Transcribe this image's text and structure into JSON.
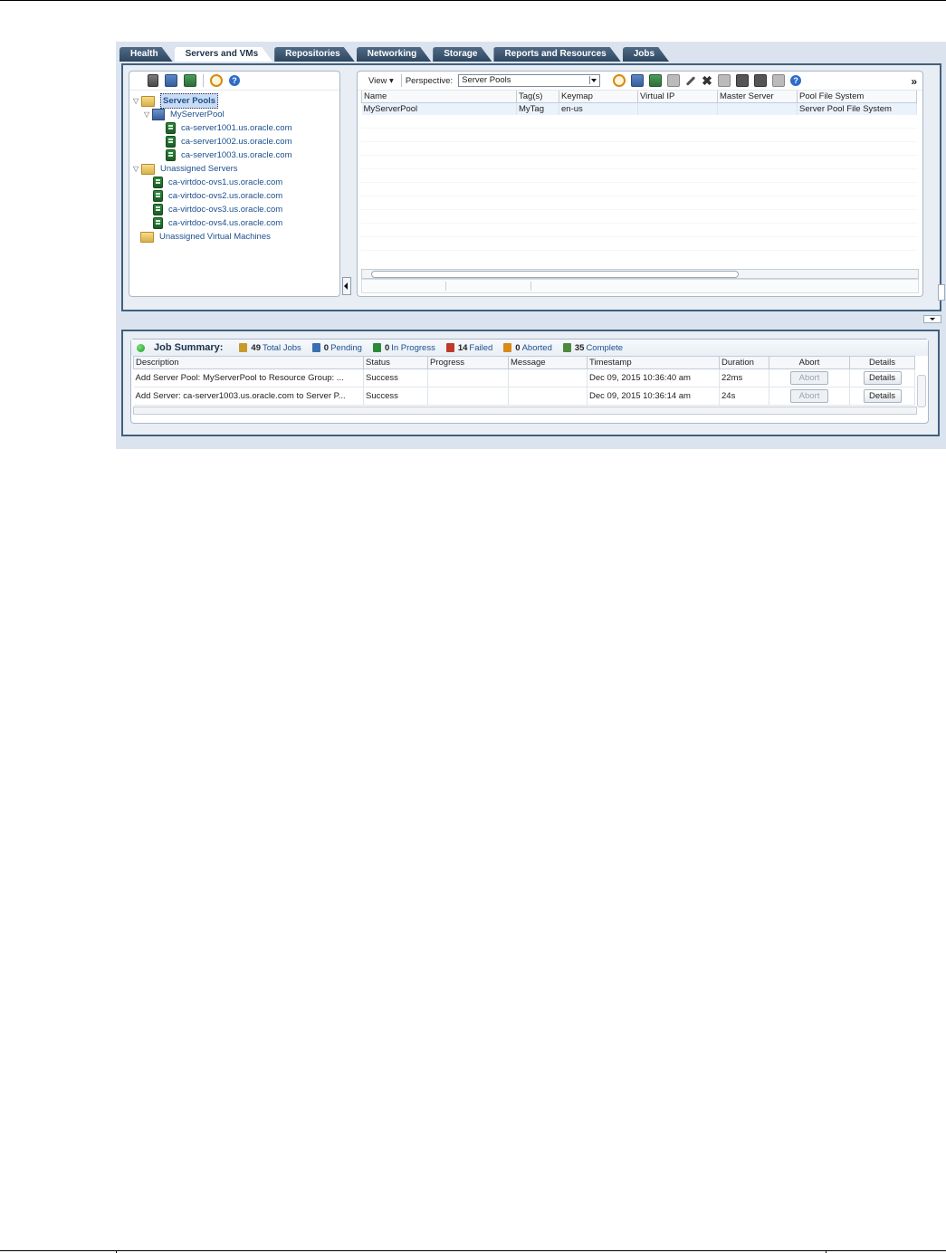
{
  "tabs": [
    {
      "label": "Health"
    },
    {
      "label": "Servers and VMs"
    },
    {
      "label": "Repositories"
    },
    {
      "label": "Networking"
    },
    {
      "label": "Storage"
    },
    {
      "label": "Reports and Resources"
    },
    {
      "label": "Jobs"
    }
  ],
  "active_tab": "Servers and VMs",
  "tree": {
    "server_pools": "Server Pools",
    "pool": "MyServerPool",
    "pool_servers": [
      "ca-server1001.us.oracle.com",
      "ca-server1002.us.oracle.com",
      "ca-server1003.us.oracle.com"
    ],
    "unassigned_servers": "Unassigned Servers",
    "unassigned_server_list": [
      "ca-virtdoc-ovs1.us.oracle.com",
      "ca-virtdoc-ovs2.us.oracle.com",
      "ca-virtdoc-ovs3.us.oracle.com",
      "ca-virtdoc-ovs4.us.oracle.com"
    ],
    "unassigned_vms": "Unassigned Virtual Machines"
  },
  "grid_toolbar": {
    "view_label": "View ▾",
    "perspective_label": "Perspective:",
    "perspective_value": "Server Pools",
    "more": "»"
  },
  "grid": {
    "columns": [
      "Name",
      "Tag(s)",
      "Keymap",
      "Virtual IP",
      "Master Server",
      "Pool File System"
    ],
    "rows": [
      {
        "name": "MyServerPool",
        "tags": "MyTag",
        "keymap": "en-us",
        "virtual_ip": "",
        "master_server": "",
        "pool_fs": "Server Pool File System"
      }
    ]
  },
  "job_summary": {
    "title": "Job Summary:",
    "total": {
      "count": "49",
      "label": "Total Jobs",
      "color": "#c79a2a"
    },
    "pending": {
      "count": "0",
      "label": "Pending",
      "color": "#3a6fb0"
    },
    "in_progress": {
      "count": "0",
      "label": "In Progress",
      "color": "#2b8a3a"
    },
    "failed": {
      "count": "14",
      "label": "Failed",
      "color": "#c0392b"
    },
    "aborted": {
      "count": "0",
      "label": "Aborted",
      "color": "#d98a17"
    },
    "complete": {
      "count": "35",
      "label": "Complete",
      "color": "#4c8a3e"
    }
  },
  "jobs_table": {
    "columns": [
      "Description",
      "Status",
      "Progress",
      "Message",
      "Timestamp",
      "Duration",
      "Abort",
      "Details"
    ],
    "rows": [
      {
        "description": "Add Server Pool: MyServerPool to Resource Group: ...",
        "status": "Success",
        "progress": "",
        "message": "",
        "timestamp": "Dec 09, 2015 10:36:40 am",
        "duration": "22ms",
        "abort": "Abort",
        "details": "Details"
      },
      {
        "description": "Add Server: ca-server1003.us.oracle.com to Server P...",
        "status": "Success",
        "progress": "",
        "message": "",
        "timestamp": "Dec 09, 2015 10:36:14 am",
        "duration": "24s",
        "abort": "Abort",
        "details": "Details"
      }
    ]
  }
}
